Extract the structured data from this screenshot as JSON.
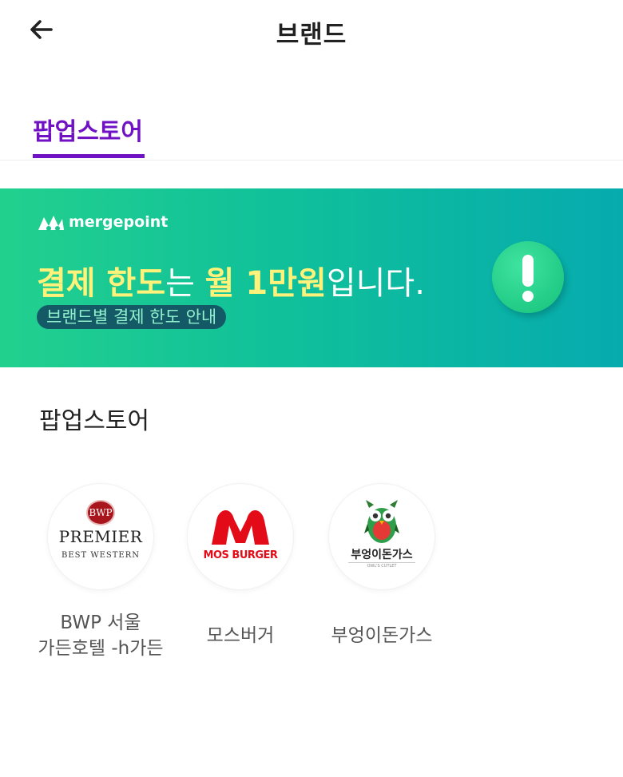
{
  "header": {
    "title": "브랜드",
    "back_icon": "arrow-left-icon"
  },
  "tabs": [
    {
      "label": "팝업스토어",
      "active": true
    }
  ],
  "banner": {
    "logo_text": "mergepoint",
    "headline_parts": [
      {
        "text": "결제 한도",
        "style": "highlight"
      },
      {
        "text": "는 ",
        "style": "plain"
      },
      {
        "text": "월 1만원",
        "style": "highlight"
      },
      {
        "text": "입니다.",
        "style": "plain"
      }
    ],
    "subtitle": "브랜드별 결제 한도 안내",
    "icon": "exclamation-icon",
    "colors": {
      "gradient_start": "#22d08e",
      "gradient_end": "#06abae",
      "highlight": "#fff27a"
    }
  },
  "section": {
    "title": "팝업스토어"
  },
  "stores": [
    {
      "name_line1": "BWP 서울",
      "name_line2": "가든호텔 -h가든",
      "logo": {
        "badge": "BWP",
        "brand": "PREMIER",
        "sub": "BEST WESTERN"
      }
    },
    {
      "name": "모스버거",
      "logo": {
        "brand": "MOS BURGER"
      }
    },
    {
      "name": "부엉이돈가스",
      "logo": {
        "brand": "부엉이돈가스",
        "sub": "OWL'S CUTLET"
      }
    }
  ],
  "colors": {
    "accent": "#7012c4",
    "mos_red": "#e30b17"
  }
}
